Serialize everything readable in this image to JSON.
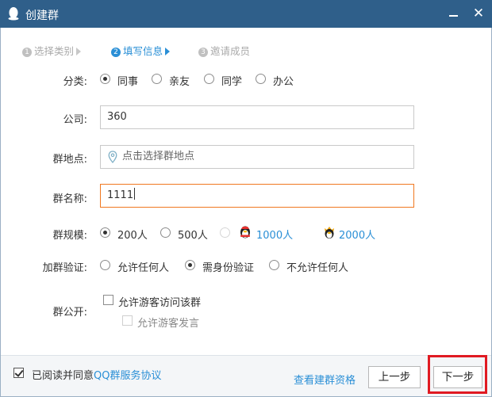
{
  "window": {
    "title": "创建群"
  },
  "steps": [
    {
      "num": "1",
      "label": "选择类别"
    },
    {
      "num": "2",
      "label": "填写信息"
    },
    {
      "num": "3",
      "label": "邀请成员"
    }
  ],
  "form": {
    "category": {
      "label": "分类:",
      "options": [
        "同事",
        "亲友",
        "同学",
        "办公"
      ],
      "selected": "同事"
    },
    "company": {
      "label": "公司:",
      "value": "360"
    },
    "location": {
      "label": "群地点:",
      "placeholder": "点击选择群地点"
    },
    "name": {
      "label": "群名称:",
      "value": "1111"
    },
    "scale": {
      "label": "群规模:",
      "options": [
        "200人",
        "500人",
        "1000人",
        "2000人"
      ],
      "selected": "200人"
    },
    "verify": {
      "label": "加群验证:",
      "options": [
        "允许任何人",
        "需身份验证",
        "不允许任何人"
      ],
      "selected": "需身份验证"
    },
    "public": {
      "label": "群公开:",
      "visitor_access": "允许游客访问该群",
      "visitor_speak": "允许游客发言"
    }
  },
  "footer": {
    "agree_prefix": "已阅读并同意",
    "agree_link": "QQ群服务协议",
    "qualification": "查看建群资格",
    "prev": "上一步",
    "next": "下一步"
  }
}
